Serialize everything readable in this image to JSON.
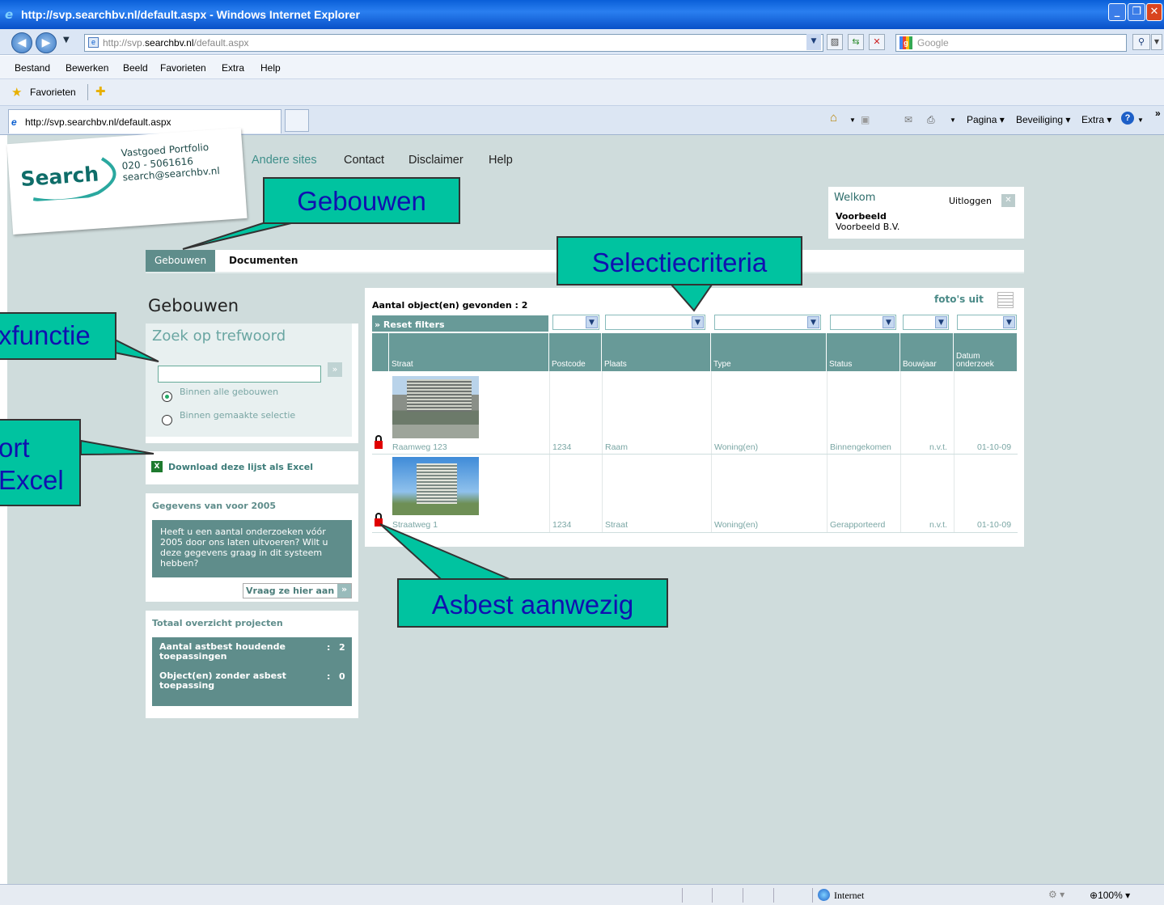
{
  "window": {
    "title": "http://svp.searchbv.nl/default.aspx - Windows Internet Explorer"
  },
  "addressbar": {
    "url_prefix": "http://svp.",
    "url_domain": "searchbv.nl",
    "url_suffix": "/default.aspx",
    "search_placeholder": "Google"
  },
  "menu": [
    "Bestand",
    "Bewerken",
    "Beeld",
    "Favorieten",
    "Extra",
    "Help"
  ],
  "favorites": {
    "label": "Favorieten"
  },
  "browser_tab": {
    "label": "http://svp.searchbv.nl/default.aspx"
  },
  "command_bar": {
    "pagina": "Pagina",
    "beveiliging": "Beveiliging",
    "extra": "Extra"
  },
  "logo": {
    "word": "Search",
    "line1": "Vastgoed Portfolio",
    "line2": "020 - 5061616",
    "line3": "search@searchbv.nl"
  },
  "topnav": [
    "Andere sites",
    "Contact",
    "Disclaimer",
    "Help"
  ],
  "welcome": {
    "title": "Welkom",
    "logout": "Uitloggen",
    "user": "Voorbeeld",
    "company": "Voorbeeld B.V."
  },
  "tabs": [
    "Gebouwen",
    "Documenten"
  ],
  "left": {
    "heading": "Gebouwen",
    "search_title": "Zoek op trefwoord",
    "search_value": "",
    "radio_all": "Binnen alle gebouwen",
    "radio_selection": "Binnen gemaakte selectie",
    "download": "Download deze lijst als Excel",
    "pre2005_title": "Gegevens van voor 2005",
    "pre2005_text": "Heeft u een aantal onderzoeken vóór 2005 door ons laten uitvoeren? Wilt u deze gegevens graag in dit systeem hebben?",
    "pre2005_button": "Vraag ze hier aan",
    "overview_title": "Totaal overzicht projecten",
    "overview_rows": [
      {
        "label": "Aantal astbest houdende toepassingen",
        "sep": ":",
        "value": "2"
      },
      {
        "label": "Object(en) zonder asbest toepassing",
        "sep": ":",
        "value": "0"
      }
    ]
  },
  "grid": {
    "count_label": "Aantal object(en) gevonden : 2",
    "photos_toggle": "foto's uit",
    "reset_filters": "» Reset filters",
    "columns": [
      "Straat",
      "Postcode",
      "Plaats",
      "Type",
      "Status",
      "Bouwjaar",
      "Datum onderzoek"
    ],
    "rows": [
      {
        "straat": "Raamweg 123",
        "postcode": "1234",
        "plaats": "Raam",
        "type": "Woning(en)",
        "status": "Binnengekomen",
        "bouwjaar": "n.v.t.",
        "datum": "01-10-09"
      },
      {
        "straat": "Straatweg 1",
        "postcode": "1234",
        "plaats": "Straat",
        "type": "Woning(en)",
        "status": "Gerapporteerd",
        "bouwjaar": "n.v.t.",
        "datum": "01-10-09"
      }
    ]
  },
  "callouts": {
    "gebouwen": "Gebouwen",
    "selectie": "Selectiecriteria",
    "zoek": "xfunctie",
    "export1": "ort",
    "export2": "Excel",
    "asbest": "Asbest aanwezig"
  },
  "statusbar": {
    "zone": "Internet",
    "zoom": "100%"
  }
}
